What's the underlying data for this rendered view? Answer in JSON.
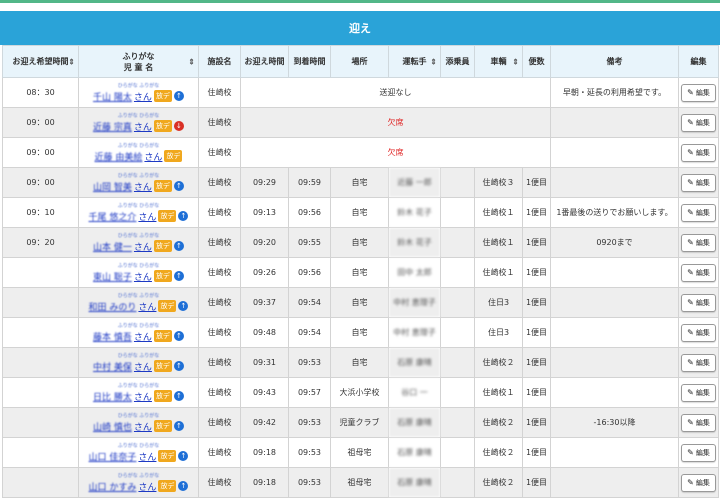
{
  "header": {
    "title": "迎え"
  },
  "columns": {
    "time": "お迎え希望時間",
    "name_top": "ふりがな",
    "name_bottom": "児 童 名",
    "facility": "施設名",
    "pickup": "お迎え時間",
    "arrival": "到着時間",
    "place": "場所",
    "driver": "運転手",
    "assistant": "添乗員",
    "vehicle": "車輌",
    "trip": "便数",
    "note": "備考",
    "edit": "編集"
  },
  "san_label": "さん",
  "badge_label": "放デ",
  "edit_label": "編集",
  "colors": {
    "header_bar": "#2aa3d8",
    "top_stripe": "#52b788",
    "absent": "#e02020",
    "badge": "#f0a81e"
  },
  "rows": [
    {
      "time": "08：30",
      "kana": "ひらがな ふりがな",
      "name": "千山 陽太",
      "arrow": "up",
      "facility": "住崎校",
      "status": "送迎なし",
      "status_color": "normal",
      "pickup": "",
      "arrival": "",
      "place": "",
      "driver": "",
      "assistant": "",
      "vehicle": "",
      "trip": "",
      "note": "早朝・延長の利用希望です。"
    },
    {
      "time": "09：00",
      "kana": "ふりがな ひらがな",
      "name": "近藤 宗真",
      "arrow": "down",
      "facility": "住崎校",
      "status": "欠席",
      "status_color": "red",
      "pickup": "",
      "arrival": "",
      "place": "",
      "driver": "",
      "assistant": "",
      "vehicle": "",
      "trip": "",
      "note": ""
    },
    {
      "time": "09：00",
      "kana": "ふりがな ひらがな",
      "name": "近藤 由美絵",
      "arrow": "",
      "facility": "住崎校",
      "status": "欠席",
      "status_color": "red",
      "pickup": "",
      "arrival": "",
      "place": "",
      "driver": "",
      "assistant": "",
      "vehicle": "",
      "trip": "",
      "note": ""
    },
    {
      "time": "09：00",
      "kana": "ひらがな ふりがな",
      "name": "山岡 智美",
      "arrow": "up",
      "facility": "住崎校",
      "status": "",
      "status_color": "normal",
      "pickup": "09:29",
      "arrival": "09:59",
      "place": "自宅",
      "driver": "近藤 一郎",
      "assistant": "",
      "vehicle": "住崎校３",
      "trip": "1便目",
      "note": ""
    },
    {
      "time": "09：10",
      "kana": "ふりがな ひらがな",
      "name": "千尾 悠之介",
      "arrow": "up",
      "facility": "住崎校",
      "status": "",
      "status_color": "normal",
      "pickup": "09:13",
      "arrival": "09:56",
      "place": "自宅",
      "driver": "鈴木 花子",
      "assistant": "",
      "vehicle": "住崎校１",
      "trip": "1便目",
      "note": "1番最後の送りでお願いします。"
    },
    {
      "time": "09：20",
      "kana": "ひらがな ふりがな",
      "name": "山本 健一",
      "arrow": "up",
      "facility": "住崎校",
      "status": "",
      "status_color": "normal",
      "pickup": "09:20",
      "arrival": "09:55",
      "place": "自宅",
      "driver": "鈴木 花子",
      "assistant": "",
      "vehicle": "住崎校１",
      "trip": "1便目",
      "note": "0920まで"
    },
    {
      "time": "",
      "kana": "ふりがな ひらがな",
      "name": "東山 聡子",
      "arrow": "up",
      "facility": "住崎校",
      "status": "",
      "status_color": "normal",
      "pickup": "09:26",
      "arrival": "09:56",
      "place": "自宅",
      "driver": "田中 太郎",
      "assistant": "",
      "vehicle": "住崎校１",
      "trip": "1便目",
      "note": ""
    },
    {
      "time": "",
      "kana": "ひらがな ふりがな",
      "name": "和田 みのり",
      "arrow": "up",
      "facility": "住崎校",
      "status": "",
      "status_color": "normal",
      "pickup": "09:37",
      "arrival": "09:54",
      "place": "自宅",
      "driver": "中村 恵理子",
      "assistant": "",
      "vehicle": "住日3",
      "trip": "1便目",
      "note": ""
    },
    {
      "time": "",
      "kana": "ふりがな ひらがな",
      "name": "藤本 慎吾",
      "arrow": "up",
      "facility": "住崎校",
      "status": "",
      "status_color": "normal",
      "pickup": "09:48",
      "arrival": "09:54",
      "place": "自宅",
      "driver": "中村 恵理子",
      "assistant": "",
      "vehicle": "住日3",
      "trip": "1便目",
      "note": ""
    },
    {
      "time": "",
      "kana": "ひらがな ふりがな",
      "name": "中村 美保",
      "arrow": "up",
      "facility": "住崎校",
      "status": "",
      "status_color": "normal",
      "pickup": "09:31",
      "arrival": "09:53",
      "place": "自宅",
      "driver": "石原 康晴",
      "assistant": "",
      "vehicle": "住崎校２",
      "trip": "1便目",
      "note": ""
    },
    {
      "time": "",
      "kana": "ふりがな ひらがな",
      "name": "日比 勝太",
      "arrow": "up",
      "facility": "住崎校",
      "status": "",
      "status_color": "normal",
      "pickup": "09:43",
      "arrival": "09:57",
      "place": "大浜小学校",
      "driver": "谷口 一",
      "assistant": "",
      "vehicle": "住崎校１",
      "trip": "1便目",
      "note": ""
    },
    {
      "time": "",
      "kana": "ひらがな ふりがな",
      "name": "山崎 慎也",
      "arrow": "up",
      "facility": "住崎校",
      "status": "",
      "status_color": "normal",
      "pickup": "09:42",
      "arrival": "09:53",
      "place": "児童クラブ",
      "driver": "石原 康晴",
      "assistant": "",
      "vehicle": "住崎校２",
      "trip": "1便目",
      "note": "-16:30以降"
    },
    {
      "time": "",
      "kana": "ふりがな ひらがな",
      "name": "山口 佳奈子",
      "arrow": "up",
      "facility": "住崎校",
      "status": "",
      "status_color": "normal",
      "pickup": "09:18",
      "arrival": "09:53",
      "place": "祖母宅",
      "driver": "石原 康晴",
      "assistant": "",
      "vehicle": "住崎校２",
      "trip": "1便目",
      "note": ""
    },
    {
      "time": "",
      "kana": "ひらがな ふりがな",
      "name": "山口 かすみ",
      "arrow": "up",
      "facility": "住崎校",
      "status": "",
      "status_color": "normal",
      "pickup": "09:18",
      "arrival": "09:53",
      "place": "祖母宅",
      "driver": "石原 康晴",
      "assistant": "",
      "vehicle": "住崎校２",
      "trip": "1便目",
      "note": ""
    }
  ]
}
